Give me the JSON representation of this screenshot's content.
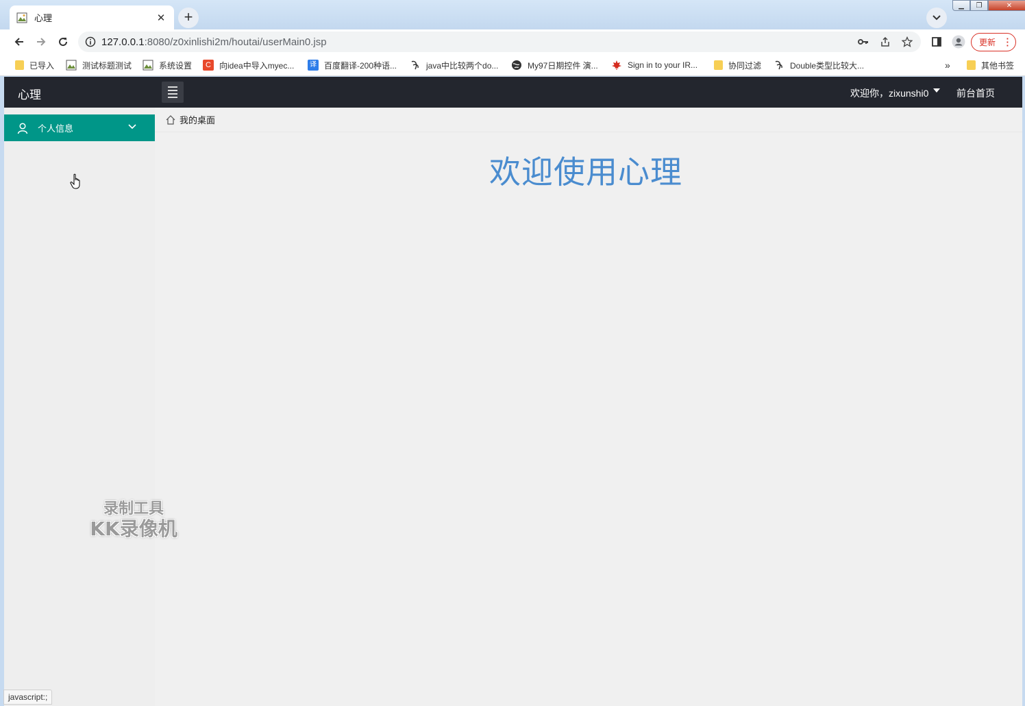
{
  "browser": {
    "tab_title": "心理",
    "url_host": "127.0.0.1",
    "url_rest": ":8080/z0xinlishi2m/houtai/userMain0.jsp",
    "update_label": "更新",
    "bookmarks": [
      {
        "label": "已导入",
        "icon": "folder-icon"
      },
      {
        "label": "测试标题测试",
        "icon": "image-icon"
      },
      {
        "label": "系统设置",
        "icon": "image-icon"
      },
      {
        "label": "向idea中导入myec...",
        "icon": "csdn-icon"
      },
      {
        "label": "百度翻译-200种语...",
        "icon": "translate-icon"
      },
      {
        "label": "java中比较两个do...",
        "icon": "sketch-icon"
      },
      {
        "label": "My97日期控件 演...",
        "icon": "globe-icon"
      },
      {
        "label": "Sign in to your IR...",
        "icon": "maple-leaf-icon"
      },
      {
        "label": "协同过滤",
        "icon": "folder-icon"
      },
      {
        "label": "Double类型比较大...",
        "icon": "sketch-icon"
      }
    ],
    "overflow_label": "»",
    "other_bookmarks": "其他书签",
    "status_text": "javascript:;"
  },
  "app": {
    "logo": "心理",
    "welcome_user": "欢迎你，zixunshi0",
    "home_link": "前台首页",
    "sidebar_item": "个人信息",
    "breadcrumb": "我的桌面",
    "welcome_title": "欢迎使用心理"
  },
  "watermark": {
    "line1": "录制工具",
    "line2": "KK录像机"
  },
  "colors": {
    "header_bg": "#23262e",
    "sidebar_active": "#009688",
    "title_blue": "#4a8ccf"
  }
}
